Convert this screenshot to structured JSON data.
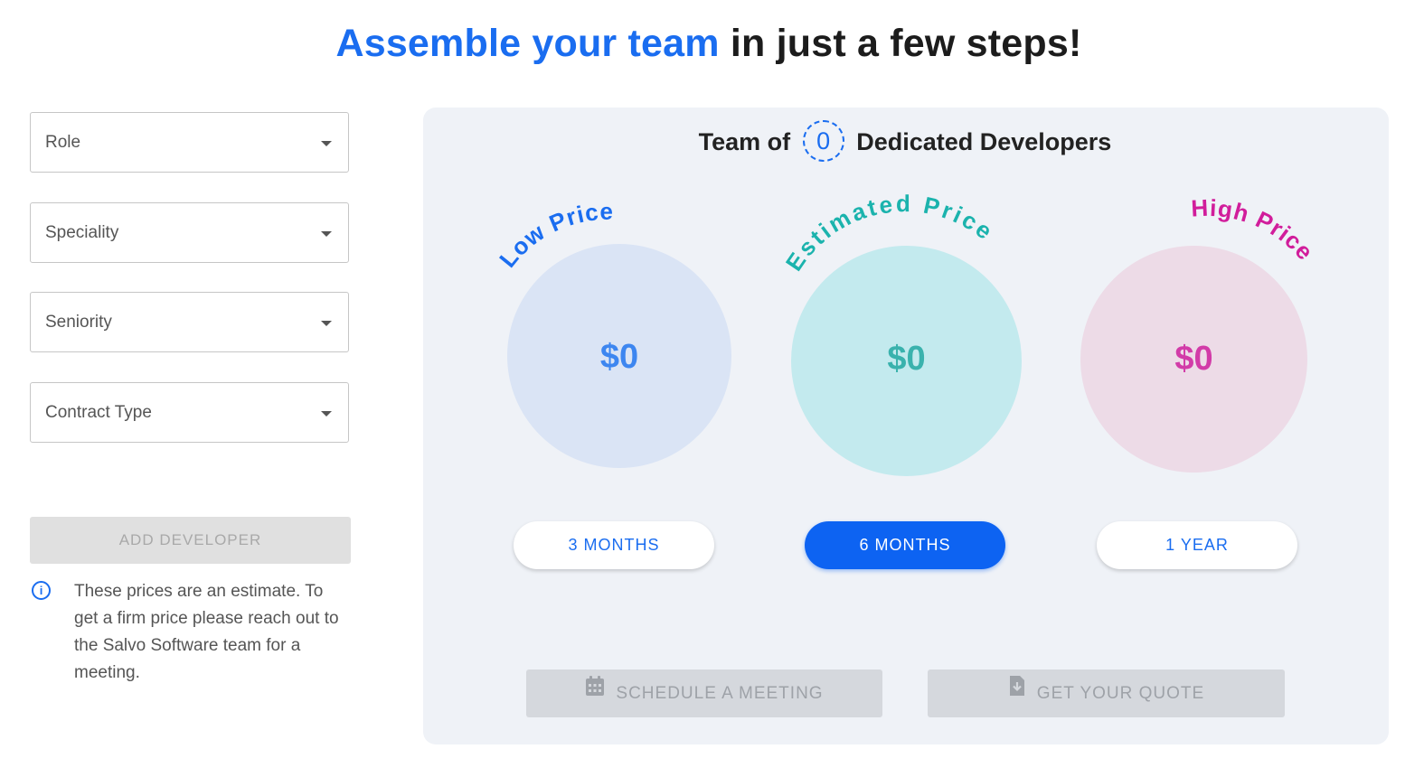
{
  "headline": {
    "accent": "Assemble your team",
    "rest": "in just a few steps!"
  },
  "filters": [
    {
      "label": "Role"
    },
    {
      "label": "Speciality"
    },
    {
      "label": "Seniority"
    },
    {
      "label": "Contract Type"
    }
  ],
  "add_developer_label": "ADD DEVELOPER",
  "note": {
    "icon": "info-icon",
    "text": "These prices are an estimate. To get a firm price please reach out to the Salvo Software team for a meeting."
  },
  "panel": {
    "team_prefix": "Team of",
    "team_count": "0",
    "team_suffix": "Dedicated Developers",
    "prices": [
      {
        "title": "Low Price",
        "value": "$0",
        "color": "#1a6df0"
      },
      {
        "title": "Estimated Price",
        "value": "$0",
        "color": "#1bb3ad"
      },
      {
        "title": "High Price",
        "value": "$0",
        "color": "#d11d9b"
      }
    ],
    "periods": [
      {
        "label": "3 MONTHS",
        "active": false
      },
      {
        "label": "6 MONTHS",
        "active": true
      },
      {
        "label": "1 YEAR",
        "active": false
      }
    ],
    "actions": [
      {
        "label": "SCHEDULE A MEETING",
        "icon": "calendar-icon"
      },
      {
        "label": "GET YOUR QUOTE",
        "icon": "download-icon"
      }
    ]
  },
  "colors": {
    "accent": "#1a6df0",
    "panel_bg": "#eff2f7",
    "active_period": "#0d63f2"
  }
}
